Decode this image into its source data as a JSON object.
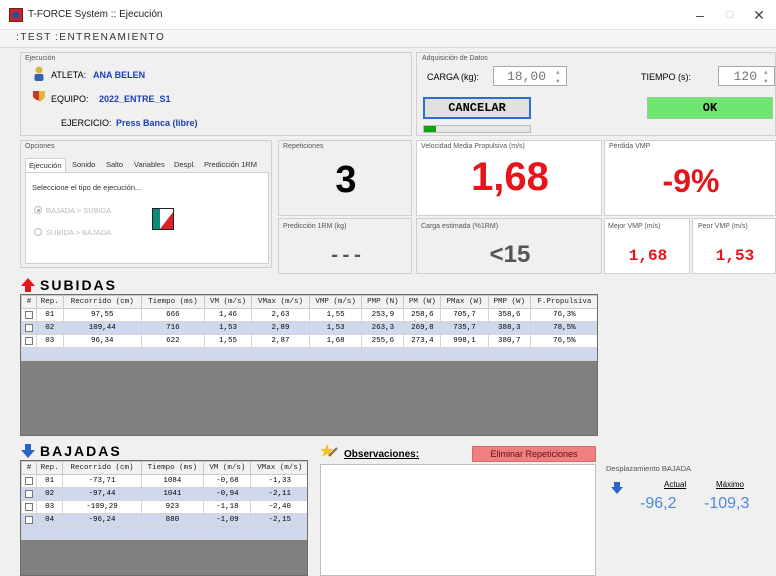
{
  "window": {
    "title": "T-FORCE System :: Ejecución",
    "minimize": "–",
    "maximize": "□",
    "close": "✕"
  },
  "menu": [
    ":TEST",
    ":ENTRENAMIENTO"
  ],
  "ejecucion": {
    "caption": "Ejecución",
    "atleta_label": "ATLETA:",
    "atleta_value": "ANA BELEN",
    "equipo_label": "EQUIPO:",
    "equipo_value": "2022_ENTRE_S1",
    "ejercicio_label": "EJERCICIO:",
    "ejercicio_value": "Press Banca (libre)"
  },
  "adquisicion": {
    "caption": "Adquisición de Datos",
    "carga_label": "CARGA (kg):",
    "carga_value": "18,00",
    "tiempo_label": "TIEMPO (s):",
    "tiempo_value": "120",
    "cancelar_label": "CANCELAR",
    "ok_label": "OK",
    "progress": 0.11
  },
  "opciones": {
    "caption": "Opciones",
    "tabs": [
      "Ejecución",
      "Sonido",
      "Salto",
      "Variables",
      "Despl.",
      "Predicción 1RM"
    ],
    "prompt": "Seleccione el tipo de ejecución...",
    "option1": "BAJADA > SUBIDA",
    "option2": "SUBIDA > BAJADA"
  },
  "metrics": {
    "repeticiones_caption": "Repeticiones",
    "repeticiones_value": "3",
    "prediccion_caption": "Predicción 1RM (kg)",
    "prediccion_value": "---",
    "vmp_caption": "Velocidad Media Propulsiva (m/s)",
    "vmp_value": "1,68",
    "carga_caption": "Carga estimada (%1RM)",
    "carga_value": "<15",
    "perdida_caption": "Pérdida VMP",
    "perdida_value": "-9%",
    "mejor_caption": "Mejor VMP (m/s)",
    "mejor_value": "1,68",
    "peor_caption": "Peor VMP (m/s)",
    "peor_value": "1,53"
  },
  "subidas": {
    "title": "SUBIDAS",
    "columns": [
      "#",
      "Rep.",
      "Recorrido (cm)",
      "Tiempo (ms)",
      "VM (m/s)",
      "VMax (m/s)",
      "VMP (m/s)",
      "PMP (N)",
      "PM (W)",
      "PMax (W)",
      "PMP (W)",
      "F.Propulsiva"
    ],
    "rows": [
      [
        "01",
        "97,55",
        "666",
        "1,46",
        "2,63",
        "1,55",
        "253,9",
        "258,6",
        "705,7",
        "358,6",
        "76,3%"
      ],
      [
        "02",
        "109,44",
        "716",
        "1,53",
        "2,89",
        "1,53",
        "263,3",
        "269,8",
        "735,7",
        "388,3",
        "78,5%"
      ],
      [
        "03",
        "96,34",
        "622",
        "1,55",
        "2,87",
        "1,68",
        "255,6",
        "273,4",
        "998,1",
        "380,7",
        "76,5%"
      ]
    ]
  },
  "bajadas": {
    "title": "BAJADAS",
    "columns": [
      "#",
      "Rep.",
      "Recorrido (cm)",
      "Tiempo (ms)",
      "VM (m/s)",
      "VMax (m/s)"
    ],
    "rows": [
      [
        "01",
        "-73,71",
        "1084",
        "-0,68",
        "-1,33"
      ],
      [
        "02",
        "-97,44",
        "1041",
        "-0,94",
        "-2,11"
      ],
      [
        "03",
        "-109,29",
        "923",
        "-1,18",
        "-2,40"
      ],
      [
        "04",
        "-96,24",
        "880",
        "-1,09",
        "-2,15"
      ]
    ]
  },
  "observaciones": {
    "label": "Observaciones:",
    "eliminar_label": "Eliminar Repeticiones"
  },
  "desplazamiento": {
    "caption": "Desplazamiento BAJADA",
    "actual_label": "Actual",
    "actual_value": "-96,2",
    "maximo_label": "Máximo",
    "maximo_value": "-109,3"
  },
  "colors": {
    "red": "#e8141b",
    "blue_value": "#4a8ae0",
    "ok_green": "#6ee56e",
    "progress_green": "#0ca60c",
    "alt_row": "#cfd8ec"
  }
}
